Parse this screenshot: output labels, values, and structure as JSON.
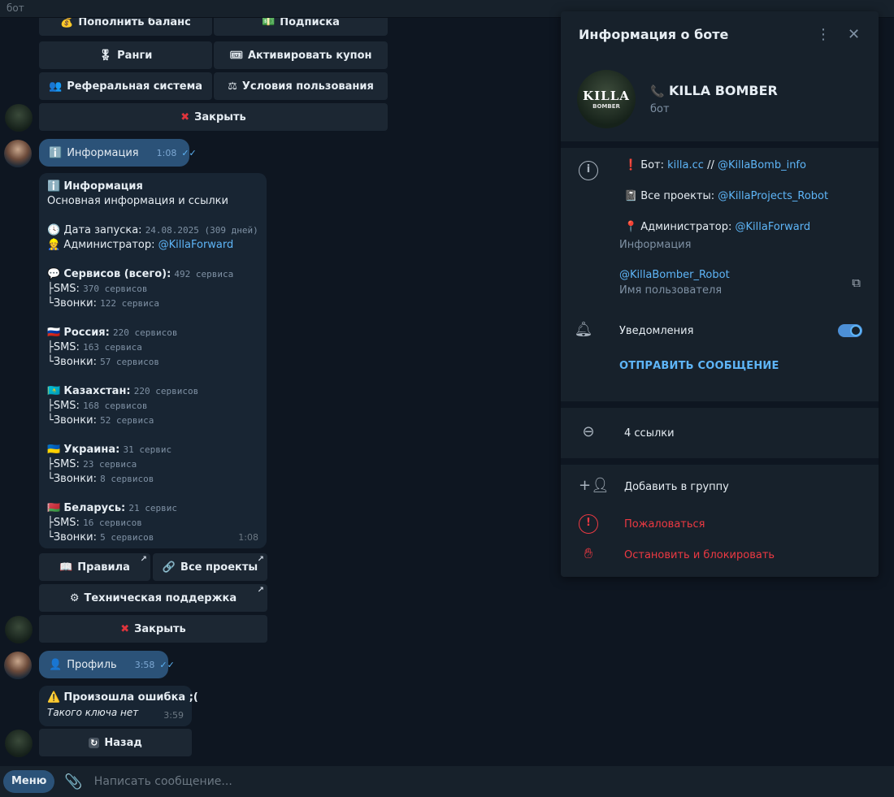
{
  "topbar": {
    "title": "бот"
  },
  "keyboard1": {
    "btn_balance": "Пополнить баланс",
    "btn_subscription": "Подписка",
    "btn_ranks": "Ранги",
    "btn_coupon": "Активировать купон",
    "btn_referral": "Реферальная система",
    "btn_terms": "Условия пользования",
    "btn_close": "Закрыть"
  },
  "out_msg1": {
    "text": "Информация",
    "time": "1:08"
  },
  "info_msg": {
    "title": "Информация",
    "subtitle": "Основная информация и ссылки",
    "launch_label": "Дата запуска:",
    "launch_value": "24.08.2025 (309 дней)",
    "admin_label": "Администратор:",
    "admin_value": "@KillaForward",
    "services_label": "Сервисов (всего):",
    "services_value": "492 сервиса",
    "services_sms_label": "├SMS:",
    "services_sms_value": "370 сервисов",
    "services_calls_label": "└Звонки:",
    "services_calls_value": "122 сервиса",
    "countries": [
      {
        "flag": "🇷🇺",
        "name": "Россия:",
        "total": "220 сервисов",
        "sms": "163 сервиса",
        "calls": "57 сервисов"
      },
      {
        "flag": "🇰🇿",
        "name": "Казахстан:",
        "total": "220 сервисов",
        "sms": "168 сервисов",
        "calls": "52 сервиса"
      },
      {
        "flag": "🇺🇦",
        "name": "Украина:",
        "total": "31 сервис",
        "sms": "23 сервиса",
        "calls": "8 сервисов"
      },
      {
        "flag": "🇧🇾",
        "name": "Беларусь:",
        "total": "21 сервис",
        "sms": "16 сервисов",
        "calls": "5 сервисов"
      }
    ],
    "sms_label": "├SMS:",
    "calls_label": "└Звонки:",
    "time": "1:08"
  },
  "keyboard2": {
    "btn_rules": "Правила",
    "btn_projects": "Все проекты",
    "btn_support": "Техническая поддержка",
    "btn_close": "Закрыть"
  },
  "out_msg2": {
    "text": "Профиль",
    "time": "3:58"
  },
  "error_msg": {
    "title": "Произошла ошибка ;(",
    "text": "Такого ключа нет",
    "time": "3:59"
  },
  "keyboard3": {
    "btn_back": "Назад"
  },
  "composer": {
    "menu_label": "Меню",
    "placeholder": "Написать сообщение..."
  },
  "panel": {
    "title": "Информация о боте",
    "bot_name": "KILLA BOMBER",
    "bot_sub": "бот",
    "avatar_text_1": "KILLA",
    "avatar_text_2": "BOMBER",
    "bio_bot_label": "Бот:",
    "bio_bot_link1": "killa.cc",
    "bio_sep": "//",
    "bio_bot_link2": "@KillaBomb_info",
    "bio_projects_label": "Все проекты:",
    "bio_projects_link": "@KillaProjects_Robot",
    "bio_admin_label": "Администратор:",
    "bio_admin_link": "@KillaForward",
    "bio_caption": "Информация",
    "username": "@KillaBomber_Robot",
    "username_caption": "Имя пользователя",
    "notifications": "Уведомления",
    "notifications_on": true,
    "send_message": "ОТПРАВИТЬ СООБЩЕНИЕ",
    "links": "4 ссылки",
    "add_to_group": "Добавить в группу",
    "report": "Пожаловаться",
    "block": "Остановить и блокировать"
  },
  "colors": {
    "accent": "#5eb5f7",
    "danger": "#ec3942",
    "bg": "#0e1621",
    "panel": "#17212b"
  }
}
